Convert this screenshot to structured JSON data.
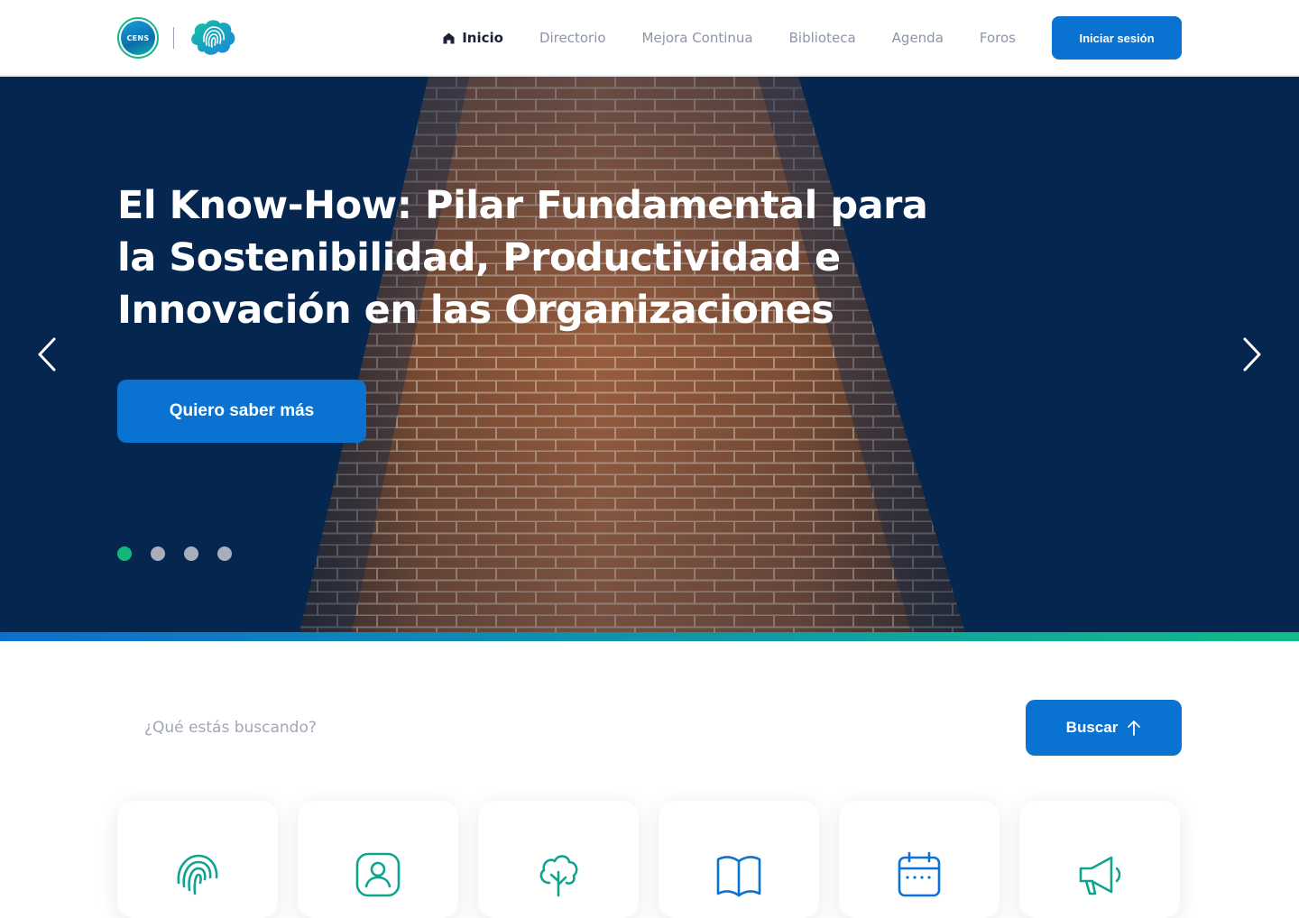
{
  "header": {
    "logo_text": "CENS",
    "nav": [
      {
        "label": "Inicio",
        "active": true,
        "icon": "home-icon"
      },
      {
        "label": "Directorio",
        "active": false
      },
      {
        "label": "Mejora Continua",
        "active": false
      },
      {
        "label": "Biblioteca",
        "active": false
      },
      {
        "label": "Agenda",
        "active": false
      },
      {
        "label": "Foros",
        "active": false
      }
    ],
    "login_label": "Iniciar sesión"
  },
  "hero": {
    "title": "El Know-How: Pilar Fundamental para la Sostenibilidad, Productividad e Innovación en las Organizaciones",
    "cta_label": "Quiero saber más",
    "slide_count": 4,
    "active_slide": 1,
    "prev_icon": "chevron-left-icon",
    "next_icon": "chevron-right-icon"
  },
  "search": {
    "placeholder": "¿Qué estás buscando?",
    "button_label": "Buscar",
    "button_icon": "arrow-up-icon"
  },
  "cards": [
    {
      "icon": "fingerprint-icon"
    },
    {
      "icon": "user-badge-icon"
    },
    {
      "icon": "cloud-tree-icon"
    },
    {
      "icon": "book-icon"
    },
    {
      "icon": "calendar-icon"
    },
    {
      "icon": "megaphone-icon"
    }
  ],
  "colors": {
    "primary": "#0a73d1",
    "accent_green": "#12b878",
    "hero_bg": "#05264e",
    "nav_text": "#8d95a6"
  }
}
